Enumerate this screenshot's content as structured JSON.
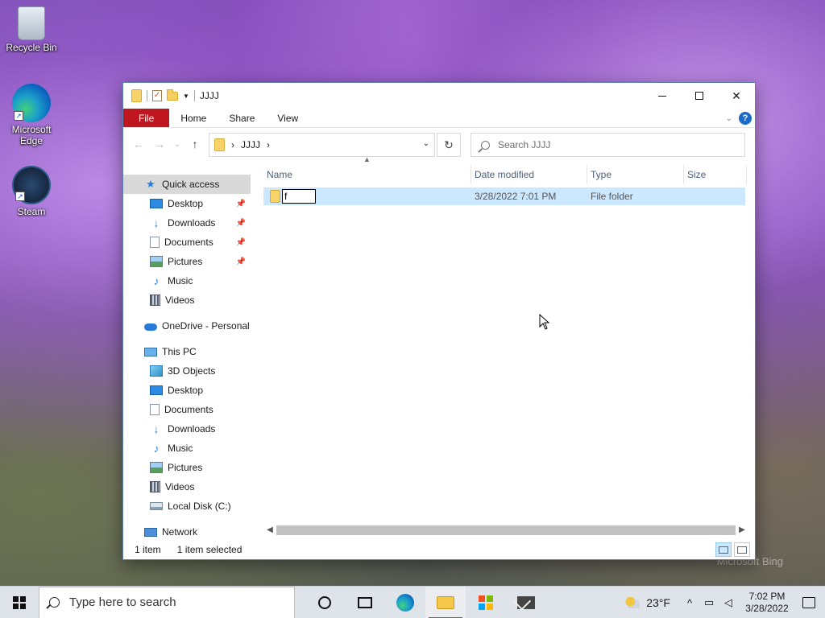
{
  "desktop": {
    "icons": [
      {
        "label": "Recycle Bin"
      },
      {
        "label": "Microsoft Edge"
      },
      {
        "label": "Steam"
      }
    ],
    "watermark": "Microsoft Bing"
  },
  "window": {
    "title": "JJJJ",
    "controls": {
      "minimize": "—",
      "maximize": "☐",
      "close": "✕"
    },
    "ribbon_tabs": [
      "File",
      "Home",
      "Share",
      "View"
    ],
    "help": "?",
    "nav": {
      "back": "←",
      "forward": "→",
      "recent": "⌄",
      "up": "↑"
    },
    "address": {
      "segments": [
        "JJJJ"
      ],
      "separator": "›"
    },
    "refresh": "↻",
    "search_placeholder": "Search JJJJ",
    "sidebar": {
      "quick_access": "Quick access",
      "quick_items": [
        "Desktop",
        "Downloads",
        "Documents",
        "Pictures",
        "Music",
        "Videos"
      ],
      "onedrive": "OneDrive - Personal",
      "this_pc": "This PC",
      "pc_items": [
        "3D Objects",
        "Desktop",
        "Documents",
        "Downloads",
        "Music",
        "Pictures",
        "Videos",
        "Local Disk (C:)"
      ],
      "network": "Network"
    },
    "columns": [
      "Name",
      "Date modified",
      "Type",
      "Size"
    ],
    "rows": [
      {
        "name_edit": "f",
        "date": "3/28/2022 7:01 PM",
        "type": "File folder",
        "size": ""
      }
    ],
    "status": {
      "count": "1 item",
      "selected": "1 item selected"
    }
  },
  "taskbar": {
    "search_placeholder": "Type here to search",
    "weather": "23°F",
    "time": "7:02 PM",
    "date": "3/28/2022"
  },
  "colors": {
    "file_tab": "#c0161f",
    "selection": "#cce8ff",
    "accent": "#1c6ac8"
  }
}
